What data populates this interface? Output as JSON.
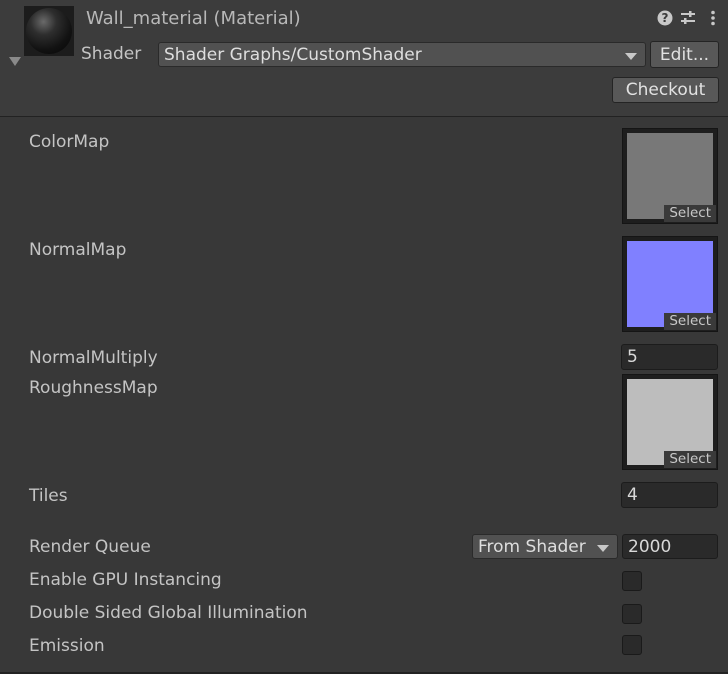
{
  "header": {
    "title": "Wall_material (Material)",
    "shader_label": "Shader",
    "shader_value": "Shader Graphs/CustomShader",
    "edit_button": "Edit...",
    "checkout_button": "Checkout",
    "icons": [
      "help-icon",
      "preset-sliders-icon",
      "more-options-icon"
    ]
  },
  "properties": {
    "color_map": {
      "label": "ColorMap",
      "select": "Select",
      "color": "#787878"
    },
    "normal_map": {
      "label": "NormalMap",
      "select": "Select",
      "color": "#8080ff"
    },
    "normal_multiply": {
      "label": "NormalMultiply",
      "value": "5"
    },
    "roughness_map": {
      "label": "RoughnessMap",
      "select": "Select",
      "color": "#bdbdbd"
    },
    "tiles": {
      "label": "Tiles",
      "value": "4"
    }
  },
  "advanced": {
    "render_queue": {
      "label": "Render Queue",
      "mode": "From Shader",
      "value": "2000"
    },
    "gpu_instancing": {
      "label": "Enable GPU Instancing",
      "checked": false
    },
    "double_sided_gi": {
      "label": "Double Sided Global Illumination",
      "checked": false
    },
    "emission": {
      "label": "Emission",
      "checked": false
    }
  }
}
